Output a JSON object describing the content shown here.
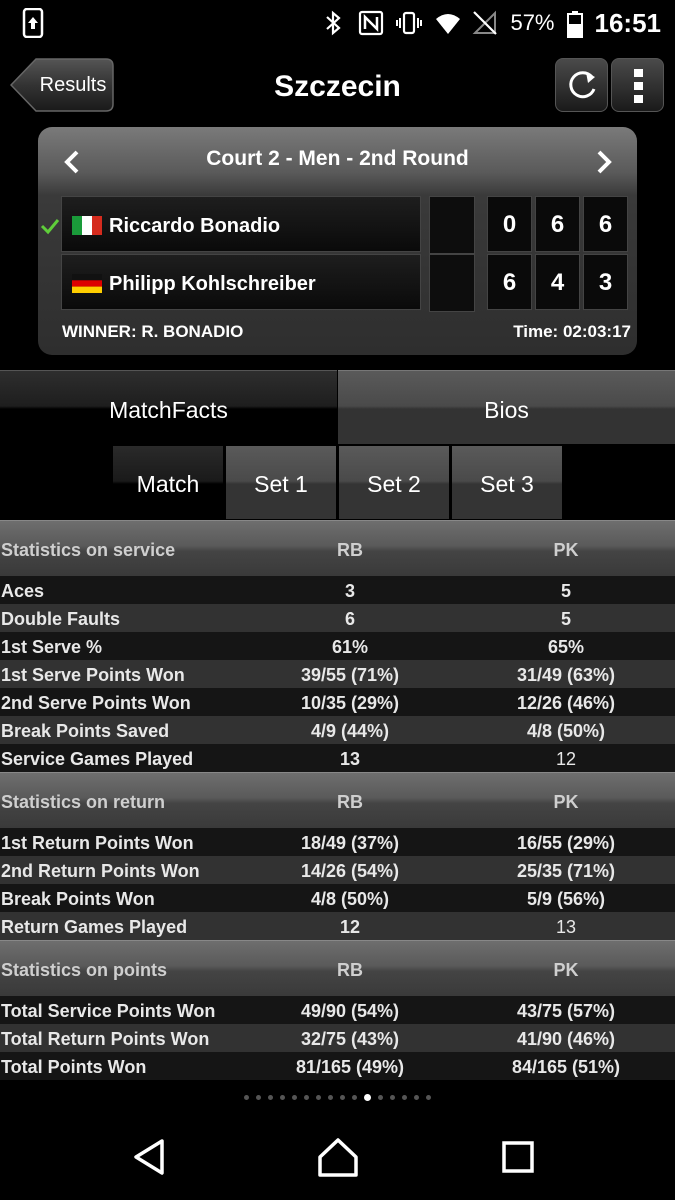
{
  "status_bar": {
    "battery": "57%",
    "time": "16:51",
    "icons": [
      "screenshot-icon",
      "bluetooth-icon",
      "nfc-icon",
      "vibrate-icon",
      "wifi-icon",
      "no-signal-icon",
      "battery-icon"
    ]
  },
  "header": {
    "back_label": "Results",
    "title": "Szczecin",
    "refresh_icon": "refresh-icon",
    "menu_icon": "more-vert-icon"
  },
  "match": {
    "round": "Court 2 - Men - 2nd Round",
    "players": [
      {
        "name": "Riccardo Bonadio",
        "flag": "italy-flag-icon",
        "winner": true,
        "sets": [
          "0",
          "6",
          "6"
        ]
      },
      {
        "name": "Philipp Kohlschreiber",
        "flag": "germany-flag-icon",
        "winner": false,
        "sets": [
          "6",
          "4",
          "3"
        ]
      }
    ],
    "winner_text": "WINNER: R. BONADIO",
    "time_text": "Time: 02:03:17"
  },
  "tabs": [
    "MatchFacts",
    "Bios"
  ],
  "subtabs": [
    "Match",
    "Set 1",
    "Set 2",
    "Set 3"
  ],
  "stats": {
    "service": {
      "title": "Statistics on service",
      "col1": "RB",
      "col2": "PK",
      "rows": [
        {
          "label": "Aces",
          "v1": "3",
          "v2": "5"
        },
        {
          "label": "Double Faults",
          "v1": "6",
          "v2": "5"
        },
        {
          "label": "1st Serve %",
          "v1": "61%",
          "v2": "65%"
        },
        {
          "label": "1st Serve Points Won",
          "v1": "39/55 (71%)",
          "v2": "31/49 (63%)"
        },
        {
          "label": "2nd Serve Points Won",
          "v1": "10/35 (29%)",
          "v2": "12/26 (46%)"
        },
        {
          "label": "Break Points Saved",
          "v1": "4/9 (44%)",
          "v2": "4/8 (50%)"
        },
        {
          "label": "Service Games Played",
          "v1": "13",
          "v2": "12"
        }
      ]
    },
    "return": {
      "title": "Statistics on return",
      "col1": "RB",
      "col2": "PK",
      "rows": [
        {
          "label": "1st Return Points Won",
          "v1": "18/49 (37%)",
          "v2": "16/55 (29%)"
        },
        {
          "label": "2nd Return Points Won",
          "v1": "14/26 (54%)",
          "v2": "25/35 (71%)"
        },
        {
          "label": "Break Points Won",
          "v1": "4/8 (50%)",
          "v2": "5/9 (56%)"
        },
        {
          "label": "Return Games Played",
          "v1": "12",
          "v2": "13"
        }
      ]
    },
    "points": {
      "title": "Statistics on points",
      "col1": "RB",
      "col2": "PK",
      "rows": [
        {
          "label": "Total Service Points Won",
          "v1": "49/90 (54%)",
          "v2": "43/75 (57%)"
        },
        {
          "label": "Total Return Points Won",
          "v1": "32/75 (43%)",
          "v2": "41/90 (46%)"
        },
        {
          "label": "Total Points Won",
          "v1": "81/165 (49%)",
          "v2": "84/165 (51%)"
        }
      ]
    }
  },
  "pager": {
    "total": 16,
    "active_index": 10
  },
  "nav": {
    "back_icon": "nav-back-icon",
    "home_icon": "nav-home-icon",
    "recents_icon": "nav-recents-icon"
  }
}
